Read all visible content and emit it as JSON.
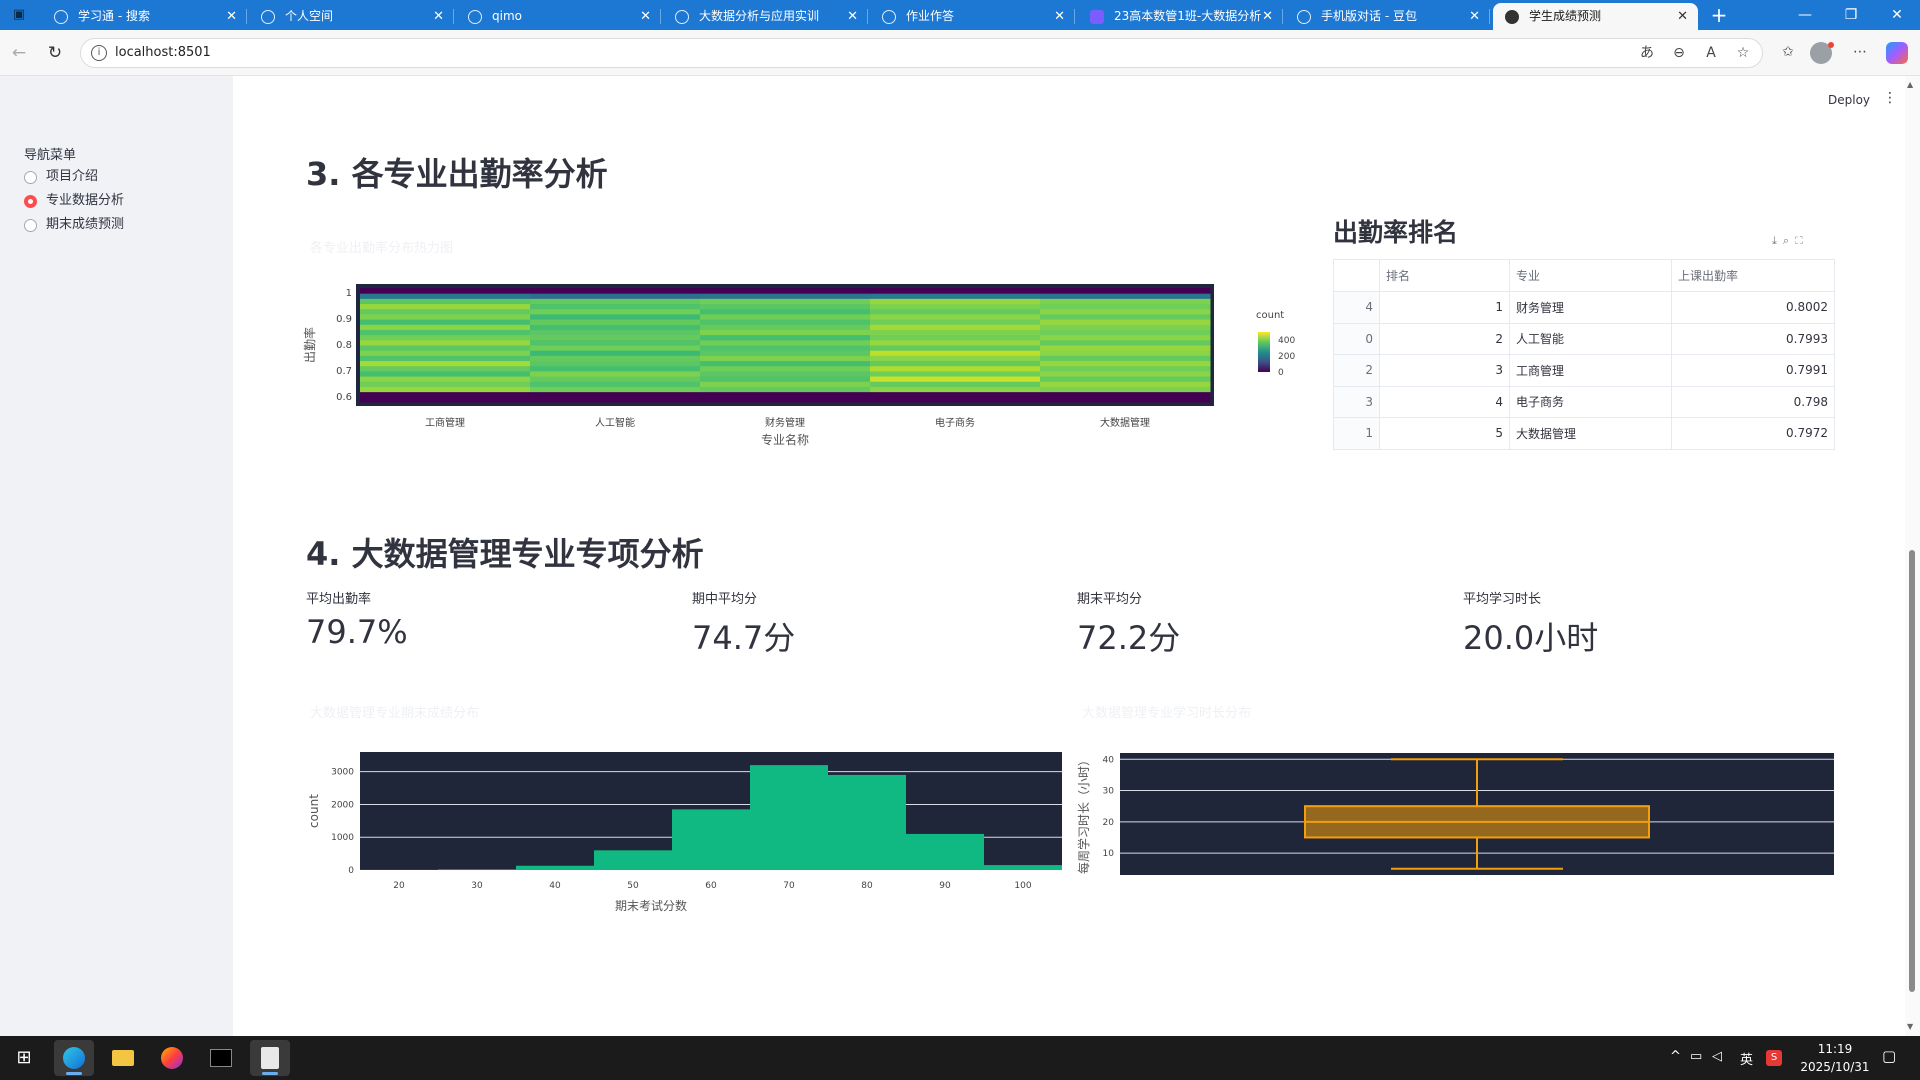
{
  "browser": {
    "tabs": [
      {
        "title": "学习通 - 搜索",
        "active": false
      },
      {
        "title": "个人空间",
        "active": false
      },
      {
        "title": "qimo",
        "active": false
      },
      {
        "title": "大数据分析与应用实训",
        "active": false
      },
      {
        "title": "作业作答",
        "active": false
      },
      {
        "title": "23高本数管1班-大数据分析",
        "active": false
      },
      {
        "title": "手机版对话 - 豆包",
        "active": false
      },
      {
        "title": "学生成绩预测",
        "active": true
      }
    ],
    "url": "localhost:8501"
  },
  "sidebar": {
    "title": "导航菜单",
    "options": [
      {
        "label": "项目介绍",
        "selected": false
      },
      {
        "label": "专业数据分析",
        "selected": true
      },
      {
        "label": "期末成绩预测",
        "selected": false
      }
    ]
  },
  "header": {
    "deploy_label": "Deploy"
  },
  "section3": {
    "title": "3. 各专业出勤率分析",
    "chart_title": "各专业出勤率分布热力图",
    "ranking_title": "出勤率排名",
    "table": {
      "columns": [
        "",
        "排名",
        "专业",
        "上课出勤率"
      ],
      "rows": [
        {
          "index": "4",
          "rank": "1",
          "major": "财务管理",
          "rate": "0.8002"
        },
        {
          "index": "0",
          "rank": "2",
          "major": "人工智能",
          "rate": "0.7993"
        },
        {
          "index": "2",
          "rank": "3",
          "major": "工商管理",
          "rate": "0.7991"
        },
        {
          "index": "3",
          "rank": "4",
          "major": "电子商务",
          "rate": "0.798"
        },
        {
          "index": "1",
          "rank": "5",
          "major": "大数据管理",
          "rate": "0.7972"
        }
      ]
    }
  },
  "section4": {
    "title": "4. 大数据管理专业专项分析",
    "metrics": [
      {
        "label": "平均出勤率",
        "value": "79.7%"
      },
      {
        "label": "期中平均分",
        "value": "74.7分"
      },
      {
        "label": "期末平均分",
        "value": "72.2分"
      },
      {
        "label": "平均学习时长",
        "value": "20.0小时"
      }
    ],
    "hist_title": "大数据管理专业期末成绩分布",
    "box_title": "大数据管理专业学习时长分布"
  },
  "chart_data": [
    {
      "type": "heatmap",
      "title": "各专业出勤率分布热力图",
      "xlabel": "专业名称",
      "ylabel": "出勤率",
      "categories": [
        "工商管理",
        "人工智能",
        "财务管理",
        "电子商务",
        "大数据管理"
      ],
      "y_ticks": [
        1,
        0.9,
        0.8,
        0.7,
        0.6
      ],
      "ylim": [
        0.58,
        1.02
      ],
      "colorbar": {
        "title": "count",
        "ticks": [
          400,
          200,
          0
        ],
        "range": [
          0,
          500
        ]
      },
      "y_bins": [
        0.59,
        0.61,
        0.63,
        0.65,
        0.67,
        0.69,
        0.71,
        0.73,
        0.75,
        0.77,
        0.79,
        0.81,
        0.83,
        0.85,
        0.87,
        0.89,
        0.91,
        0.93,
        0.95,
        0.97,
        0.99,
        1.01
      ],
      "z": [
        [
          5,
          30,
          420,
          390,
          410,
          350,
          380,
          430,
          360,
          400,
          370,
          420,
          390,
          360,
          410,
          350,
          400,
          380,
          420,
          370,
          200,
          10
        ],
        [
          5,
          30,
          390,
          360,
          380,
          400,
          350,
          370,
          380,
          340,
          390,
          360,
          380,
          370,
          350,
          380,
          340,
          390,
          360,
          380,
          180,
          10
        ],
        [
          5,
          30,
          380,
          400,
          360,
          370,
          390,
          350,
          400,
          370,
          360,
          390,
          350,
          400,
          380,
          360,
          390,
          350,
          370,
          390,
          190,
          10
        ],
        [
          5,
          30,
          410,
          380,
          460,
          390,
          440,
          380,
          410,
          450,
          380,
          420,
          390,
          400,
          430,
          390,
          410,
          380,
          400,
          420,
          200,
          10
        ],
        [
          5,
          30,
          400,
          420,
          380,
          410,
          390,
          420,
          380,
          410,
          420,
          380,
          410,
          390,
          400,
          420,
          380,
          410,
          390,
          400,
          190,
          10
        ]
      ]
    },
    {
      "type": "bar",
      "title": "大数据管理专业期末成绩分布",
      "xlabel": "期末考试分数",
      "ylabel": "count",
      "x_ticks": [
        20,
        30,
        40,
        50,
        60,
        70,
        80,
        90,
        100
      ],
      "y_ticks": [
        0,
        1000,
        2000,
        3000
      ],
      "xlim": [
        15,
        105
      ],
      "ylim": [
        0,
        3600
      ],
      "bins": [
        {
          "start": 15,
          "end": 25,
          "count": 5
        },
        {
          "start": 25,
          "end": 35,
          "count": 20
        },
        {
          "start": 35,
          "end": 45,
          "count": 130
        },
        {
          "start": 45,
          "end": 55,
          "count": 600
        },
        {
          "start": 55,
          "end": 65,
          "count": 1850
        },
        {
          "start": 65,
          "end": 75,
          "count": 3200
        },
        {
          "start": 75,
          "end": 85,
          "count": 2900
        },
        {
          "start": 85,
          "end": 95,
          "count": 1100
        },
        {
          "start": 95,
          "end": 105,
          "count": 150
        }
      ],
      "bar_color": "#10b981"
    },
    {
      "type": "box",
      "title": "大数据管理专业学习时长分布",
      "ylabel": "每周学习时长（小时）",
      "y_ticks": [
        10,
        20,
        30,
        40
      ],
      "ylim": [
        3,
        42
      ],
      "box": {
        "min": 5,
        "q1": 15,
        "median": 20,
        "q3": 25,
        "max": 40
      },
      "box_color": "#f59e0b"
    }
  ],
  "taskbar": {
    "time": "11:19",
    "date": "2025/10/31",
    "ime": "英"
  }
}
